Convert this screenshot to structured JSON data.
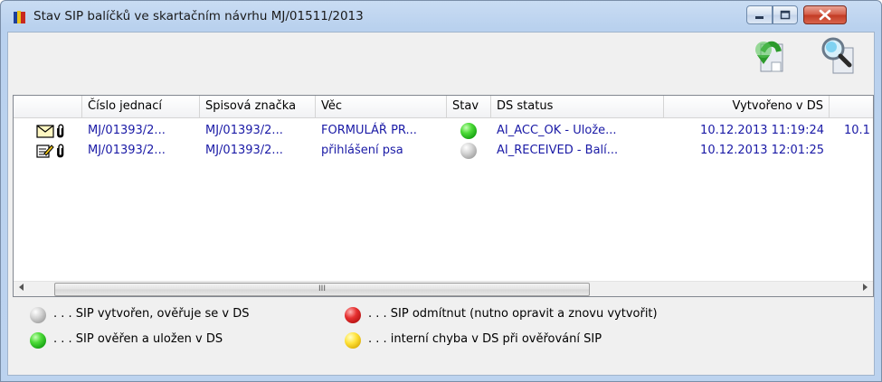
{
  "window": {
    "title": "Stav SIP balíčků ve skartačním návrhu MJ/01511/2013",
    "buttons": {
      "minimize_icon": "minimize-icon",
      "maximize_icon": "maximize-icon",
      "close_icon": "close-icon"
    }
  },
  "toolbar": {
    "items": [
      {
        "name": "send-to-ds-icon",
        "description": "export/send"
      },
      {
        "name": "search-ds-icon",
        "description": "search"
      }
    ]
  },
  "table": {
    "columns": [
      "",
      "Číslo jednací",
      "Spisová značka",
      "Věc",
      "Stav",
      "DS status",
      "Vytvořeno v DS",
      ""
    ],
    "rows": [
      {
        "type_icon": "envelope-icon",
        "attachment_icon": "paperclip-icon",
        "cislo": "MJ/01393/2...",
        "znacka": "MJ/01393/2...",
        "vec": "FORMULÁŘ PR...",
        "stav": "green",
        "ds_status": "AI_ACC_OK - Ulože...",
        "vytvoreno": "10.12.2013 11:19:24",
        "extra": "10.1"
      },
      {
        "type_icon": "edit-document-icon",
        "attachment_icon": "paperclip-icon",
        "cislo": "MJ/01393/2...",
        "znacka": "MJ/01393/2...",
        "vec": "přihlášení psa",
        "stav": "gray",
        "ds_status": "AI_RECEIVED - Balí...",
        "vytvoreno": "10.12.2013 12:01:25",
        "extra": ""
      }
    ],
    "scrollbar": {
      "grip": "III"
    }
  },
  "legend": [
    {
      "color": "gray",
      "text": ". . . SIP vytvořen, ověřuje se v DS"
    },
    {
      "color": "red",
      "text": ". . . SIP odmítnut (nutno opravit a znovu vytvořit)"
    },
    {
      "color": "green",
      "text": ". . . SIP ověřen a uložen v DS"
    },
    {
      "color": "yellow",
      "text": ". . . interní chyba v DS při ověřování SIP"
    }
  ],
  "colors": {
    "link_text": "#1a1aa6",
    "titlebar": "#bcd3ef",
    "close_button": "#c23a23"
  }
}
